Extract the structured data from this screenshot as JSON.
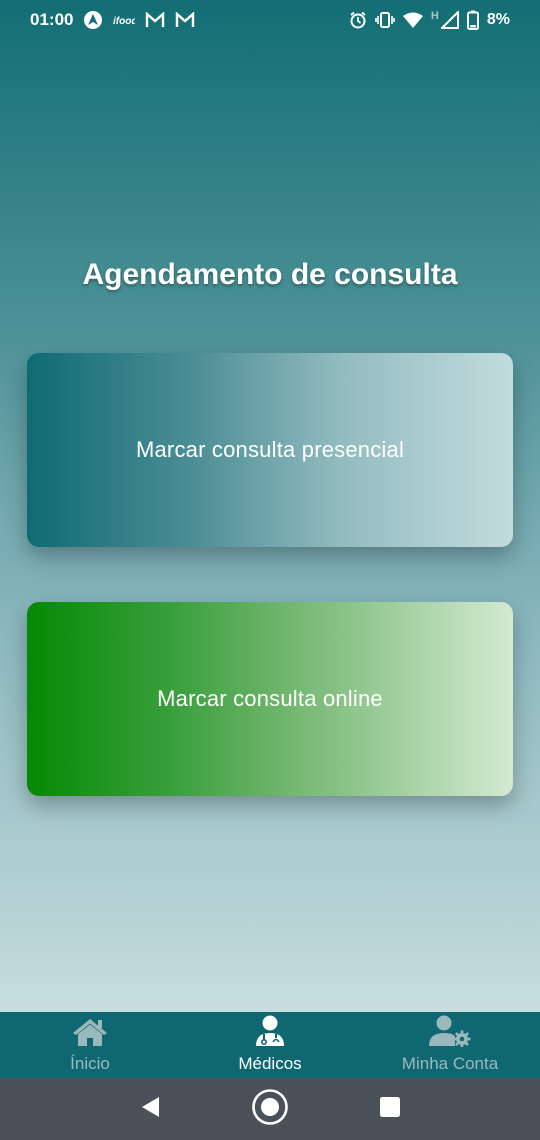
{
  "status_bar": {
    "time": "01:00",
    "battery": "8%",
    "network_letter": "H",
    "left_icons": [
      "nav-app-icon",
      "ifood-icon",
      "gmail-icon",
      "gmail-icon"
    ],
    "right_icons": [
      "alarm-icon",
      "vibrate-icon",
      "wifi-icon",
      "signal-icon",
      "battery-icon"
    ]
  },
  "page": {
    "title": "Agendamento de consulta"
  },
  "cards": {
    "presencial": {
      "label": "Marcar consulta presencial"
    },
    "online": {
      "label": "Marcar consulta online"
    }
  },
  "bottom_nav": {
    "items": [
      {
        "label": "Ínicio",
        "icon": "home-icon",
        "active": false
      },
      {
        "label": "Médicos",
        "icon": "doctor-icon",
        "active": true
      },
      {
        "label": "Minha Conta",
        "icon": "user-settings-icon",
        "active": false
      }
    ]
  },
  "system_nav": {
    "buttons": [
      "back-icon",
      "home-circle-icon",
      "recents-icon"
    ]
  },
  "colors": {
    "nav_bar": "#0f6871",
    "nav_inactive": "#9ab9bd",
    "nav_active": "#ffffff",
    "presencial_start": "#0f6a74",
    "online_start": "#048a04"
  }
}
